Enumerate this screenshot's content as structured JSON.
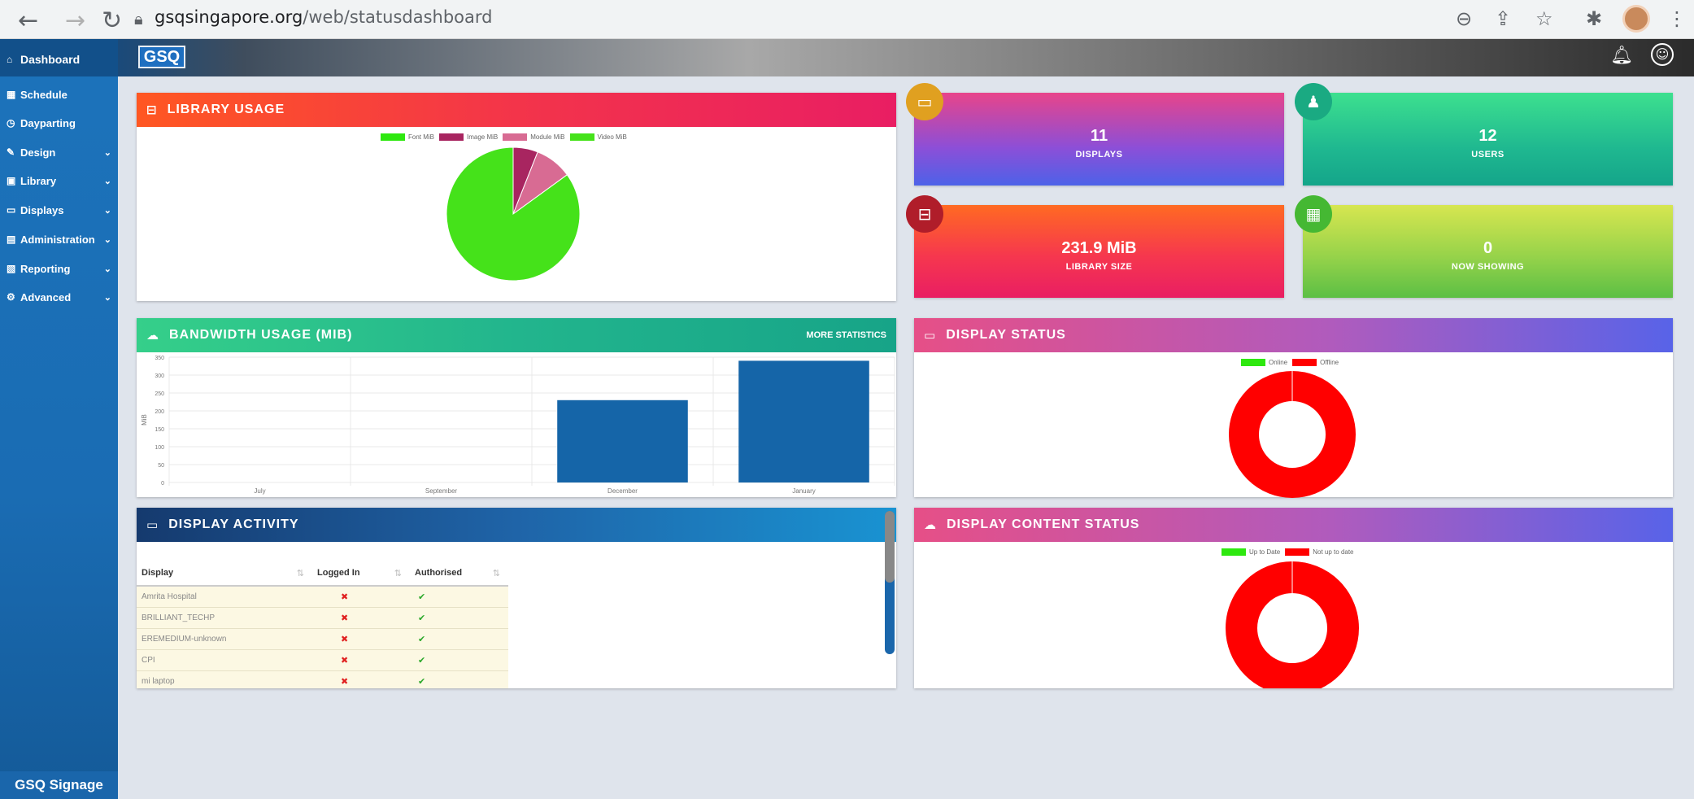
{
  "browser": {
    "url_domain": "gsqsingapore.org",
    "url_path": "/web/statusdashboard"
  },
  "sidebar": {
    "items": [
      {
        "label": "Dashboard",
        "icon": "home-icon",
        "glyph": "⌂",
        "has_sub": false
      },
      {
        "label": "Schedule",
        "icon": "calendar-icon",
        "glyph": "▦",
        "has_sub": false
      },
      {
        "label": "Dayparting",
        "icon": "clock-icon",
        "glyph": "◷",
        "has_sub": false
      },
      {
        "label": "Design",
        "icon": "pencil-icon",
        "glyph": "✎",
        "has_sub": true
      },
      {
        "label": "Library",
        "icon": "lock-icon",
        "glyph": "▣",
        "has_sub": true
      },
      {
        "label": "Displays",
        "icon": "laptop-icon",
        "glyph": "▭",
        "has_sub": true
      },
      {
        "label": "Administration",
        "icon": "badge-icon",
        "glyph": "▤",
        "has_sub": true
      },
      {
        "label": "Reporting",
        "icon": "file-icon",
        "glyph": "▧",
        "has_sub": true
      },
      {
        "label": "Advanced",
        "icon": "cog-icon",
        "glyph": "⚙",
        "has_sub": true
      }
    ],
    "footer": "GSQ Signage",
    "chevron": "⌄"
  },
  "header": {
    "logo": "GSQ"
  },
  "library_usage": {
    "title": "LIBRARY USAGE",
    "legend": [
      {
        "label": "Font MiB",
        "color": "#2ee80f"
      },
      {
        "label": "Image MiB",
        "color": "#a82560"
      },
      {
        "label": "Module MiB",
        "color": "#d86b93"
      },
      {
        "label": "Video MiB",
        "color": "#45e21a"
      }
    ]
  },
  "stats": {
    "displays": {
      "value": "11",
      "label": "DISPLAYS"
    },
    "users": {
      "value": "12",
      "label": "USERS"
    },
    "library_size": {
      "value": "231.9 MiB",
      "label": "LIBRARY SIZE"
    },
    "now_showing": {
      "value": "0",
      "label": "NOW SHOWING"
    }
  },
  "bandwidth": {
    "title": "BANDWIDTH USAGE (MIB)",
    "more": "MORE STATISTICS"
  },
  "display_status": {
    "title": "DISPLAY STATUS",
    "legend": [
      {
        "label": "Online",
        "color": "#2ee80f"
      },
      {
        "label": "Offline",
        "color": "#ff0000"
      }
    ]
  },
  "display_activity": {
    "title": "DISPLAY ACTIVITY",
    "columns": [
      "Display",
      "Logged In",
      "Authorised"
    ],
    "rows": [
      {
        "display": "Amrita Hospital",
        "logged_in": "✖",
        "authorised": "✔"
      },
      {
        "display": "BRILLIANT_TECHP",
        "logged_in": "✖",
        "authorised": "✔"
      },
      {
        "display": "EREMEDIUM-unknown",
        "logged_in": "✖",
        "authorised": "✔"
      },
      {
        "display": "CPI",
        "logged_in": "✖",
        "authorised": "✔"
      },
      {
        "display": "mi laptop",
        "logged_in": "✖",
        "authorised": "✔"
      }
    ]
  },
  "display_content_status": {
    "title": "DISPLAY CONTENT STATUS",
    "legend": [
      {
        "label": "Up to Date",
        "color": "#2ee80f"
      },
      {
        "label": "Not up to date",
        "color": "#ff0000"
      }
    ]
  },
  "chart_data": [
    {
      "type": "pie",
      "labels": [
        "Font MiB",
        "Image MiB",
        "Module MiB",
        "Video MiB"
      ],
      "values": [
        0,
        6,
        9,
        85
      ],
      "colors": [
        "#2ee80f",
        "#a82560",
        "#d86b93",
        "#45e21a"
      ]
    },
    {
      "type": "bar",
      "categories": [
        "July",
        "September",
        "December",
        "January"
      ],
      "values": [
        0,
        0,
        230,
        340
      ],
      "ylabel": "MiB",
      "ylim": [
        0,
        350
      ],
      "yticks": [
        0,
        50,
        100,
        150,
        200,
        250,
        300,
        350
      ],
      "color": "#1565a8"
    },
    {
      "type": "pie",
      "labels": [
        "Online",
        "Offline"
      ],
      "values": [
        0,
        11
      ],
      "colors": [
        "#2ee80f",
        "#ff0000"
      ]
    },
    {
      "type": "pie",
      "labels": [
        "Up to Date",
        "Not up to date"
      ],
      "values": [
        0,
        11
      ],
      "colors": [
        "#2ee80f",
        "#ff0000"
      ]
    }
  ]
}
